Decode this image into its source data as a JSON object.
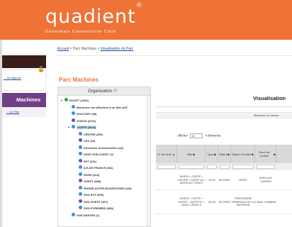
{
  "header": {
    "logo": "quadient",
    "logo_mark": "®",
    "tagline": "Désormais Connectivité Ciblé"
  },
  "breadcrumb": {
    "home": "Accueil",
    "sep1": " > ",
    "middle": "Parc Machines",
    "sep2": " > ",
    "current": "Visualisation du Parc"
  },
  "sidebar": {
    "link": "... de l'agence",
    "active_item": "Machines",
    "sub_link": "... du Parc"
  },
  "page_title": "Parc Machines",
  "org_panel": {
    "title": "Organisation",
    "tree": [
      {
        "label": "ROOPT (2404)",
        "expanded": true,
        "icon": "globe"
      },
      {
        "label": "Machines non affectées à un Site (457",
        "icon": "sub"
      },
      {
        "label": "DOCCORY (98)",
        "icon": "sub"
      },
      {
        "label": "GOEOS (2041)",
        "icon": "sub"
      },
      {
        "label": "DOFFP (3640)",
        "expanded": true,
        "selected": true,
        "icon": "sub"
      },
      {
        "label": "CENTRE (250)",
        "icon": "sub"
      },
      {
        "label": "CSX (15)",
        "icon": "sub"
      },
      {
        "label": "Directions fonctionnelles (44)",
        "icon": "sub"
      },
      {
        "label": "DSSO SUD-OUEST (2)",
        "icon": "sub"
      },
      {
        "label": "EST (261)",
        "icon": "sub"
      },
      {
        "label": "ILE-DE-FRANCE (381)",
        "icon": "sub"
      },
      {
        "label": "NORD (313)",
        "icon": "sub"
      },
      {
        "label": "OUEST (388)",
        "icon": "sub"
      },
      {
        "label": "RHONE-ALPES-BOURGOGNE (444)",
        "icon": "sub"
      },
      {
        "label": "SUD-EST (355)",
        "icon": "sub"
      },
      {
        "label": "SUD-OUEST (397)",
        "icon": "sub"
      },
      {
        "label": "SUD-PYRENEES (388)",
        "icon": "sub"
      },
      {
        "label": "DGE NANTES (1)",
        "icon": "sub"
      }
    ]
  },
  "visualisation": {
    "title": "Visualisation",
    "sub_header": "Machines du niveau",
    "show_prefix": "Afficher",
    "show_value": "10",
    "show_suffix": "éléments",
    "columns": [
      "N° de série",
      "Site",
      "Type",
      "Statut",
      "Raison Sociale",
      "Fond. du contrat"
    ],
    "rows": [
      {
        "serie": "",
        "site": "MHETH > DGFIP > CENTRE > DDFIP 18 > AURILLAC CEDEX",
        "type": "IS-05",
        "statut": "EN PARC",
        "raison": "DDFIP",
        "fond": "AURILLAC CARNES"
      },
      {
        "serie": "",
        "site": "MHETH > DGFIP > OUEST > DDFIP 53 > LAVAL CEDEX 9",
        "type": "IM-32",
        "statut": "EN PARC",
        "raison": "TRESORERIE GENERALE DE LA MAYENNE",
        "fond": "LAVAL CAMERAI"
      }
    ]
  }
}
